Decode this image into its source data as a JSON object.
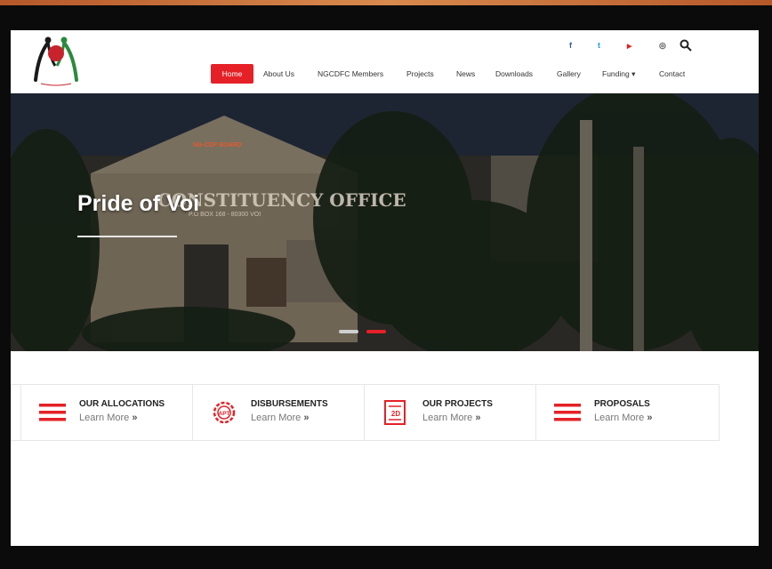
{
  "header": {
    "social": [
      {
        "icon": "facebook-icon",
        "glyph": "f",
        "color": "#3b5998"
      },
      {
        "icon": "twitter-icon",
        "glyph": "t",
        "color": "#1da1f2"
      },
      {
        "icon": "youtube-icon",
        "glyph": "▶",
        "color": "#e62117"
      },
      {
        "icon": "instagram-icon",
        "glyph": "◎",
        "color": "#555555"
      }
    ],
    "nav": [
      "Home",
      "About Us",
      "NGCDFC Members",
      "Projects",
      "News",
      "Downloads",
      "Gallery",
      "Funding ▾",
      "Contact"
    ],
    "active_color": "#e52127"
  },
  "hero": {
    "title": "Pride of Voi",
    "sign_line1": "NG-CDF BOARD",
    "sign_line2": "CONSTITUENCY OFFICE",
    "sign_line3": "P.O BOX 168 - 80300 VOI",
    "slide_count": 2,
    "active_slide": 2
  },
  "features": [
    {
      "title": "OUR ALLOCATIONS",
      "link": "Learn More",
      "icon": "menu-icon"
    },
    {
      "title": "DISBURSEMENTS",
      "link": "Learn More",
      "icon": "gear-icon",
      "badge": "APT"
    },
    {
      "title": "OUR PROJECTS",
      "link": "Learn More",
      "icon": "blueprint-icon",
      "badge": "2D"
    },
    {
      "title": "PROPOSALS",
      "link": "Learn More",
      "icon": "menu-icon"
    }
  ],
  "feature_arrow": "»",
  "colors": {
    "accent": "#e52127",
    "frame": "#0b0b0b",
    "strip": "#c46d39"
  }
}
